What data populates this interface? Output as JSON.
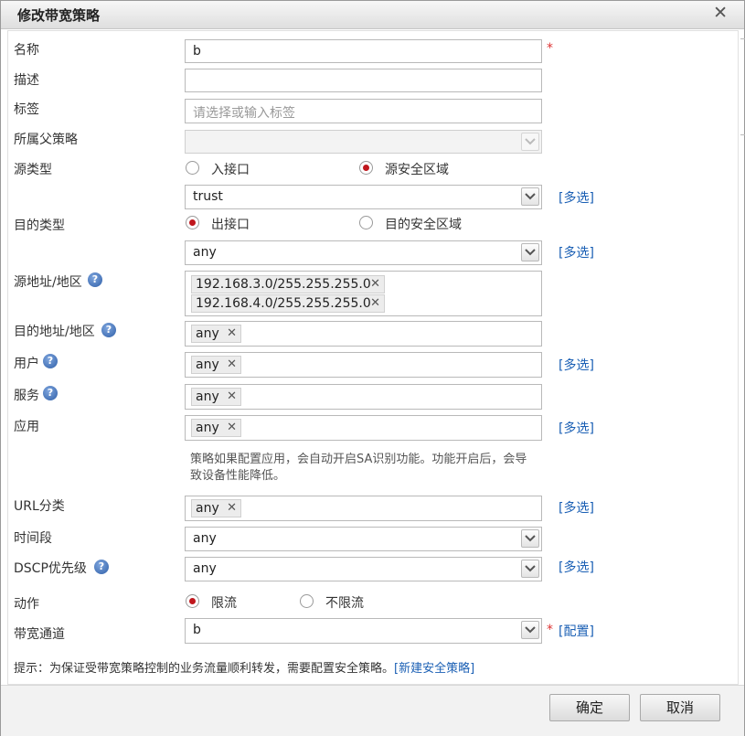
{
  "dialog": {
    "title": "修改带宽策略"
  },
  "icons": {
    "close": "close-icon",
    "dropdown": "chevron-down-icon",
    "help": "help-icon",
    "remove": "remove-tag-icon"
  },
  "fields": {
    "name": {
      "label": "名称",
      "value": "b",
      "required": "*"
    },
    "description": {
      "label": "描述",
      "value": ""
    },
    "tags": {
      "label": "标签",
      "placeholder": "请选择或输入标签"
    },
    "parent_policy": {
      "label": "所属父策略",
      "value": ""
    },
    "source_type": {
      "label": "源类型",
      "option1": "入接口",
      "option2": "源安全区域",
      "selected": "源安全区域"
    },
    "source_zone": {
      "value": "trust",
      "multi_link": "[多选]"
    },
    "dest_type": {
      "label": "目的类型",
      "option1": "出接口",
      "option2": "目的安全区域",
      "selected": "出接口"
    },
    "dest_interface": {
      "value": "any",
      "multi_link": "[多选]"
    },
    "source_address": {
      "label": "源地址/地区",
      "tags": [
        "192.168.3.0/255.255.255.0",
        "192.168.4.0/255.255.255.0"
      ]
    },
    "dest_address": {
      "label": "目的地址/地区",
      "tags": [
        "any"
      ]
    },
    "user": {
      "label": "用户",
      "tags": [
        "any"
      ],
      "multi_link": "[多选]"
    },
    "service": {
      "label": "服务",
      "tags": [
        "any"
      ]
    },
    "application": {
      "label": "应用",
      "tags": [
        "any"
      ],
      "multi_link": "[多选]",
      "note": "策略如果配置应用，会自动开启SA识别功能。功能开启后，会导致设备性能降低。"
    },
    "url_category": {
      "label": "URL分类",
      "tags": [
        "any"
      ],
      "multi_link": "[多选]"
    },
    "time_range": {
      "label": "时间段",
      "value": "any"
    },
    "dscp": {
      "label": "DSCP优先级",
      "value": "any",
      "multi_link": "[多选]"
    },
    "action": {
      "label": "动作",
      "option1": "限流",
      "option2": "不限流",
      "selected": "限流"
    },
    "bandwidth_channel": {
      "label": "带宽通道",
      "value": "b",
      "required": "*",
      "config_link": "[配置]"
    }
  },
  "hint": {
    "text": "提示：为保证受带宽策略控制的业务流量顺利转发，需要配置安全策略。",
    "link": "[新建安全策略]"
  },
  "buttons": {
    "ok": "确定",
    "cancel": "取消"
  },
  "colors": {
    "radio_selected": "#c0171d",
    "link": "#1a5fb4",
    "required": "#dd3333"
  }
}
